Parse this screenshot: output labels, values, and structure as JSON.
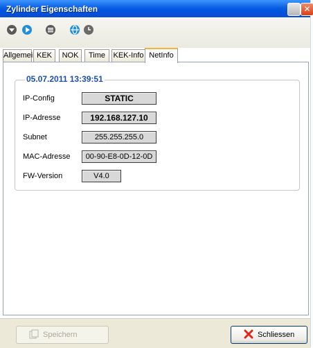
{
  "window": {
    "title": "Zylinder Eigenschaften"
  },
  "toolbar": {
    "icons": [
      "down-arrow-icon",
      "play-icon",
      "list-icon",
      "globe-icon",
      "clock-icon"
    ]
  },
  "tabs": [
    {
      "label": "Allgemein"
    },
    {
      "label": "KEK"
    },
    {
      "label": "NOK"
    },
    {
      "label": "Time"
    },
    {
      "label": "KEK-Info"
    },
    {
      "label": "NetInfo",
      "active": true
    }
  ],
  "netinfo": {
    "timestamp": "05.07.2011 13:39:51",
    "rows": [
      {
        "label": "IP-Config",
        "value": "STATIC"
      },
      {
        "label": "IP-Adresse",
        "value": "192.168.127.10"
      },
      {
        "label": "Subnet",
        "value": "255.255.255.0"
      },
      {
        "label": "MAC-Adresse",
        "value": "00-90-E8-0D-12-0D"
      },
      {
        "label": "FW-Version",
        "value": "V4.0"
      }
    ]
  },
  "buttons": {
    "save": "Speichern",
    "close": "Schliessen"
  },
  "colors": {
    "titlebar": "#0054e3",
    "group_title": "#1b4fae",
    "active_tab_accent": "#f6b23a"
  }
}
